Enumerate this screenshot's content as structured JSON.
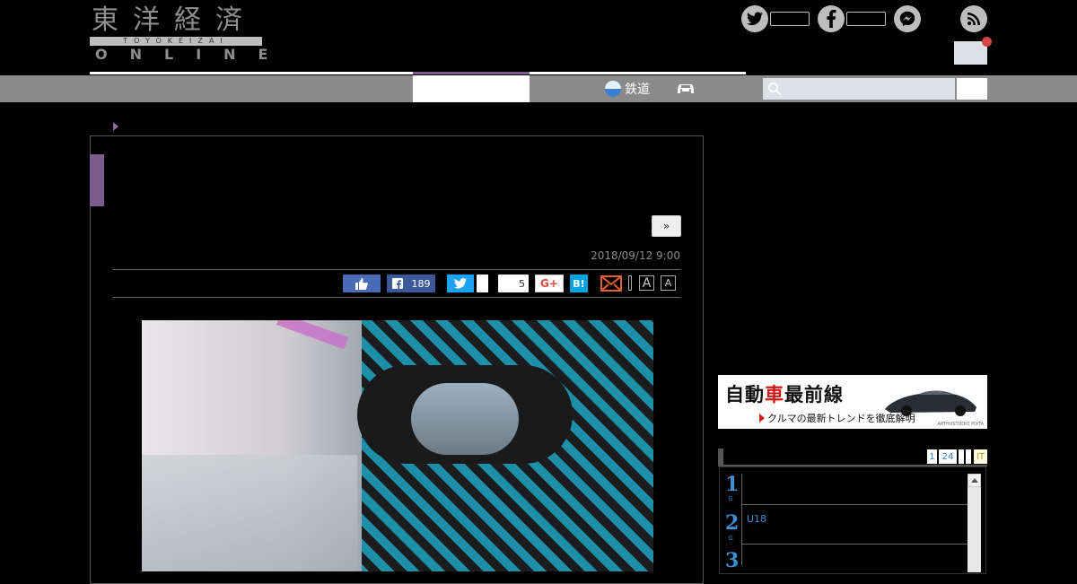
{
  "header": {
    "logo_kanji": "東洋経済",
    "logo_roman": "TOYOKEIZAI",
    "logo_online": "ONLINE"
  },
  "nav": {
    "rail_label": "鉄道"
  },
  "search": {
    "placeholder": ""
  },
  "article": {
    "next_label": "»",
    "date": "2018/09/12 9:00",
    "share": {
      "facebook_count": "189",
      "comment_count": "5",
      "gplus_label": "G+",
      "hatena_label": "B!",
      "font_large": "A",
      "font_small": "A"
    }
  },
  "sidebar": {
    "banner": {
      "title_part1": "自動",
      "title_red": "車",
      "title_part2": "最前線",
      "subtitle": "クルマの最新トレンドを徹底解明",
      "credit": "ARTHUSTUDIO PIXTA"
    },
    "ranking": {
      "tabs": [
        "1",
        "24",
        "",
        "",
        "IT"
      ],
      "items": [
        {
          "rank": "1",
          "label": ""
        },
        {
          "rank": "2",
          "label": "U18"
        },
        {
          "rank": "3",
          "label": ""
        }
      ],
      "rank_suffix": "位"
    }
  }
}
